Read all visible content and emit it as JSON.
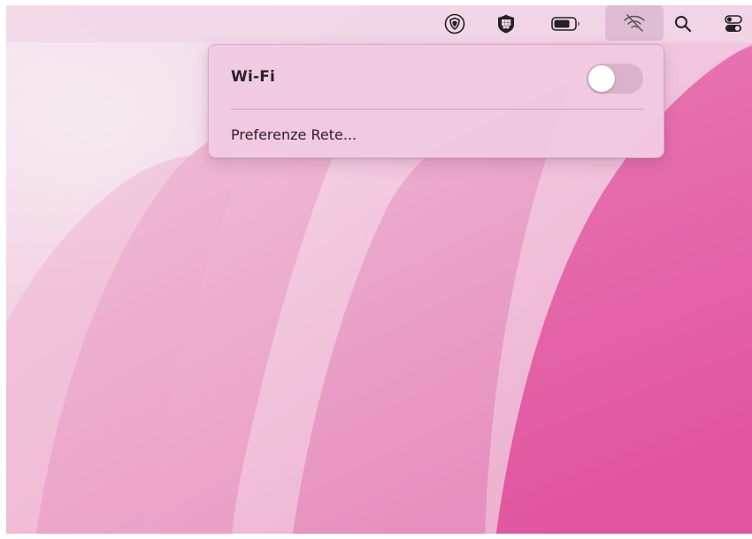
{
  "menubar": {
    "items": [
      {
        "name": "vpn-shield-icon",
        "label": "VPN"
      },
      {
        "name": "grid-app-icon",
        "label": "App"
      },
      {
        "name": "battery-icon",
        "label": "Batteria"
      },
      {
        "name": "wifi-off-icon",
        "label": "Wi-Fi"
      },
      {
        "name": "search-icon",
        "label": "Spotlight"
      },
      {
        "name": "control-center-icon",
        "label": "Centro di Controllo"
      }
    ]
  },
  "wifi_menu": {
    "title": "Wi-Fi",
    "toggle_on": false,
    "preferences_label": "Preferenze Rete..."
  },
  "colors": {
    "wallpaper_light": "#f3d6e6",
    "wallpaper_mid": "#ec9fc6",
    "wallpaper_deep": "#e25aa3",
    "menu_bg": "#f1c9e2"
  }
}
